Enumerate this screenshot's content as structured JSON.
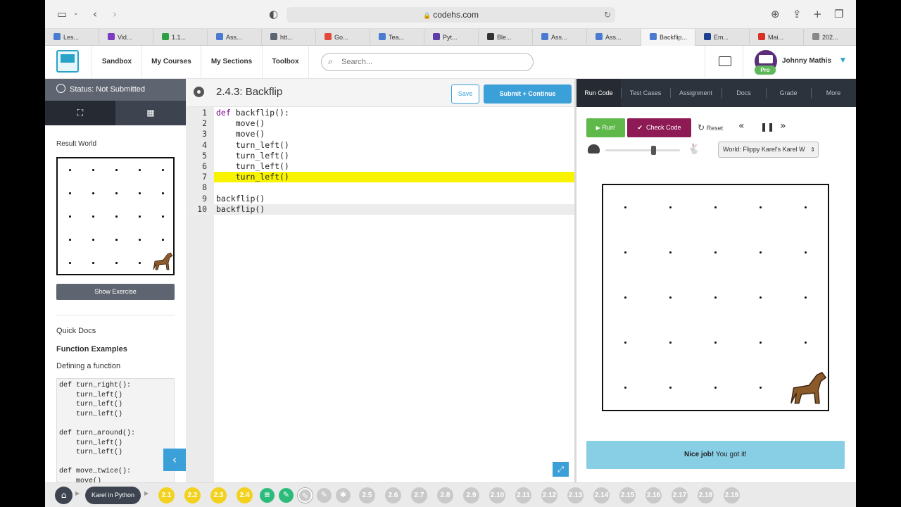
{
  "browser": {
    "url": "codehs.com",
    "tabs": [
      {
        "label": "Les...",
        "color": "#4a7bd0"
      },
      {
        "label": "Vid...",
        "color": "#7b3cc2"
      },
      {
        "label": "1.1...",
        "color": "#2f9e44"
      },
      {
        "label": "Ass...",
        "color": "#4a7bd0"
      },
      {
        "label": "htt...",
        "color": "#5c6470"
      },
      {
        "label": "Go...",
        "color": "#e04a3a"
      },
      {
        "label": "Tea...",
        "color": "#4a7bd0"
      },
      {
        "label": "Pyt...",
        "color": "#5b3ca8"
      },
      {
        "label": "Ble...",
        "color": "#333333"
      },
      {
        "label": "Ass...",
        "color": "#4a7bd0"
      },
      {
        "label": "Ass...",
        "color": "#4a7bd0"
      },
      {
        "label": "Backflip...",
        "color": "#4a7bd0"
      },
      {
        "label": "Em...",
        "color": "#1d3f8f"
      },
      {
        "label": "Mai...",
        "color": "#d93025"
      },
      {
        "label": "202...",
        "color": "#888888"
      }
    ]
  },
  "header": {
    "nav": [
      "Sandbox",
      "My Courses",
      "My Sections",
      "Toolbox"
    ],
    "search_placeholder": "Search...",
    "username": "Johnny Mathis",
    "badge": "Pro"
  },
  "sidebar": {
    "status": "Status: Not Submitted",
    "result_world_label": "Result World",
    "show_exercise": "Show Exercise",
    "quick_docs": "Quick Docs",
    "function_examples": "Function Examples",
    "defining": "Defining a function",
    "doc_code": "def turn_right():\n    turn_left()\n    turn_left()\n    turn_left()\n\ndef turn_around():\n    turn_left()\n    turn_left()\n\ndef move_twice():\n    move()"
  },
  "editor": {
    "title": "2.4.3: Backflip",
    "save": "Save",
    "submit": "Submit + Continue",
    "lines": [
      {
        "n": "1",
        "text": "def backflip():"
      },
      {
        "n": "2",
        "text": "    move()"
      },
      {
        "n": "3",
        "text": "    move()"
      },
      {
        "n": "4",
        "text": "    turn_left()"
      },
      {
        "n": "5",
        "text": "    turn_left()"
      },
      {
        "n": "6",
        "text": "    turn_left()"
      },
      {
        "n": "7",
        "text": "    turn_left()"
      },
      {
        "n": "8",
        "text": ""
      },
      {
        "n": "9",
        "text": "backflip()"
      },
      {
        "n": "10",
        "text": "backflip()"
      }
    ],
    "highlighted_line": 7,
    "cursor_line": 10
  },
  "right_panel": {
    "tabs": [
      "Run Code",
      "Test Cases",
      "Assignment",
      "Docs",
      "Grade",
      "More"
    ],
    "active_tab": "Run Code",
    "run": "Run!",
    "check": "Check Code",
    "reset": "Reset",
    "world_select": "World: Flippy Karel's Karel W",
    "nice_bold": "Nice job!",
    "nice_rest": " You got it!"
  },
  "bottom": {
    "unit": "Karel in Python",
    "steps": [
      {
        "label": "2.1",
        "state": "done"
      },
      {
        "label": "2.2",
        "state": "done"
      },
      {
        "label": "2.3",
        "state": "done"
      },
      {
        "label": "2.4",
        "state": "done"
      },
      {
        "label": "2.5",
        "state": "todo"
      },
      {
        "label": "2.6",
        "state": "todo"
      },
      {
        "label": "2.7",
        "state": "todo"
      },
      {
        "label": "2.8",
        "state": "todo"
      },
      {
        "label": "2.9",
        "state": "todo"
      },
      {
        "label": "2.10",
        "state": "todo"
      },
      {
        "label": "2.11",
        "state": "todo"
      },
      {
        "label": "2.12",
        "state": "todo"
      },
      {
        "label": "2.13",
        "state": "todo"
      },
      {
        "label": "2.14",
        "state": "todo"
      },
      {
        "label": "2.15",
        "state": "todo"
      },
      {
        "label": "2.16",
        "state": "todo"
      },
      {
        "label": "2.17",
        "state": "todo"
      },
      {
        "label": "2.18",
        "state": "todo"
      },
      {
        "label": "2.19",
        "state": "todo"
      }
    ]
  },
  "colors": {
    "accent": "#3b9fd8",
    "run": "#5fb84a",
    "check": "#8d1a54",
    "highlight": "#f8f400",
    "success": "#88cfe6"
  }
}
